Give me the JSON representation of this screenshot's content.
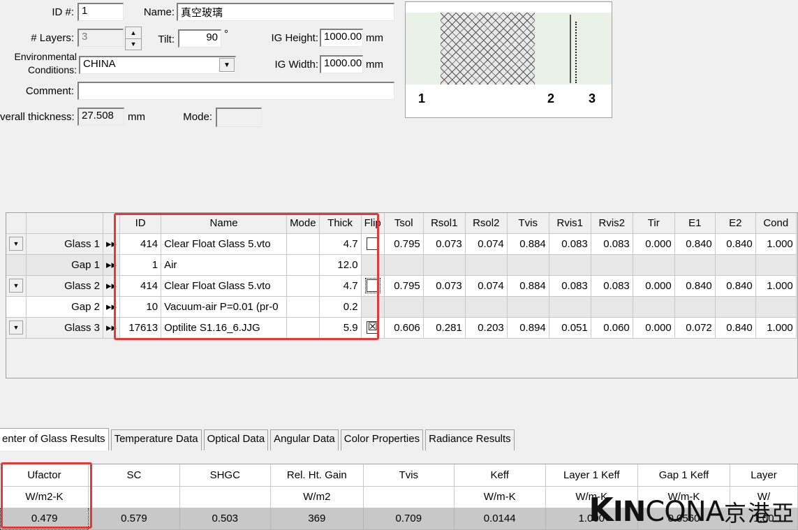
{
  "form": {
    "id_label": "ID #:",
    "id_value": "1",
    "name_label": "Name:",
    "name_value": "真空玻璃",
    "layers_label": "# Layers:",
    "layers_value": "3",
    "tilt_label": "Tilt:",
    "tilt_value": "90",
    "tilt_unit": "°",
    "igh_label": "IG Height:",
    "igh_value": "1000.00",
    "igh_unit": "mm",
    "env_label_1": "Environmental",
    "env_label_2": "Conditions:",
    "env_value": "CHINA",
    "igw_label": "IG Width:",
    "igw_value": "1000.00",
    "igw_unit": "mm",
    "comment_label": "Comment:",
    "comment_value": "",
    "thick_label": "verall thickness:",
    "thick_value": "27.508",
    "thick_unit": "mm",
    "mode_label": "Mode:",
    "mode_value": ""
  },
  "preview": {
    "labels": [
      "1",
      "2",
      "3"
    ]
  },
  "layers": {
    "columns": [
      "",
      "",
      "",
      "ID",
      "Name",
      "Mode",
      "Thick",
      "Flip",
      "Tsol",
      "Rsol1",
      "Rsol2",
      "Tvis",
      "Rvis1",
      "Rvis2",
      "Tir",
      "E1",
      "E2",
      "Cond"
    ],
    "rows": [
      {
        "type": "glass",
        "label": "Glass 1",
        "id": "414",
        "name": "Clear Float Glass 5.vto",
        "mode": "",
        "thick": "4.7",
        "flip": "",
        "tsol": "0.795",
        "rsol1": "0.073",
        "rsol2": "0.074",
        "tvis": "0.884",
        "rvis1": "0.083",
        "rvis2": "0.083",
        "tir": "0.000",
        "e1": "0.840",
        "e2": "0.840",
        "cond": "1.000"
      },
      {
        "type": "gap",
        "label": "Gap 1",
        "id": "1",
        "name": "Air",
        "mode": "",
        "thick": "12.0"
      },
      {
        "type": "glass",
        "label": "Glass 2",
        "id": "414",
        "name": "Clear Float Glass 5.vto",
        "mode": "",
        "thick": "4.7",
        "flip": "",
        "tsol": "0.795",
        "rsol1": "0.073",
        "rsol2": "0.074",
        "tvis": "0.884",
        "rvis1": "0.083",
        "rvis2": "0.083",
        "tir": "0.000",
        "e1": "0.840",
        "e2": "0.840",
        "cond": "1.000"
      },
      {
        "type": "gap",
        "label": "Gap 2",
        "id": "10",
        "name": "Vacuum-air P=0.01 (pr-0",
        "mode": "",
        "thick": "0.2"
      },
      {
        "type": "glass",
        "label": "Glass 3",
        "id": "17613",
        "name": "Optilite S1.16_6.JJG",
        "mode": "",
        "thick": "5.9",
        "flip": "☒",
        "tsol": "0.606",
        "rsol1": "0.281",
        "rsol2": "0.203",
        "tvis": "0.894",
        "rvis1": "0.051",
        "rvis2": "0.060",
        "tir": "0.000",
        "e1": "0.072",
        "e2": "0.840",
        "cond": "1.000"
      }
    ],
    "arrow_glyph": "▸▸",
    "dropdown_glyph": "▼"
  },
  "tabs": [
    "enter of Glass Results",
    "Temperature Data",
    "Optical Data",
    "Angular Data",
    "Color Properties",
    "Radiance Results"
  ],
  "results": {
    "headers": [
      "Ufactor",
      "SC",
      "SHGC",
      "Rel. Ht. Gain",
      "Tvis",
      "Keff",
      "Layer 1 Keff",
      "Gap 1 Keff",
      "Layer"
    ],
    "units": [
      "W/m2-K",
      "",
      "",
      "W/m2",
      "",
      "W/m-K",
      "W/m-K",
      "W/m-K",
      "W/"
    ],
    "values": [
      "0.479",
      "0.579",
      "0.503",
      "369",
      "0.709",
      "0.0144",
      "1.000",
      "0.0560",
      "1.00"
    ]
  },
  "watermark": {
    "logo_k": "K",
    "logo_in": "IN",
    "logo_cona": "CONA",
    "logo_cn": "京港亞"
  }
}
